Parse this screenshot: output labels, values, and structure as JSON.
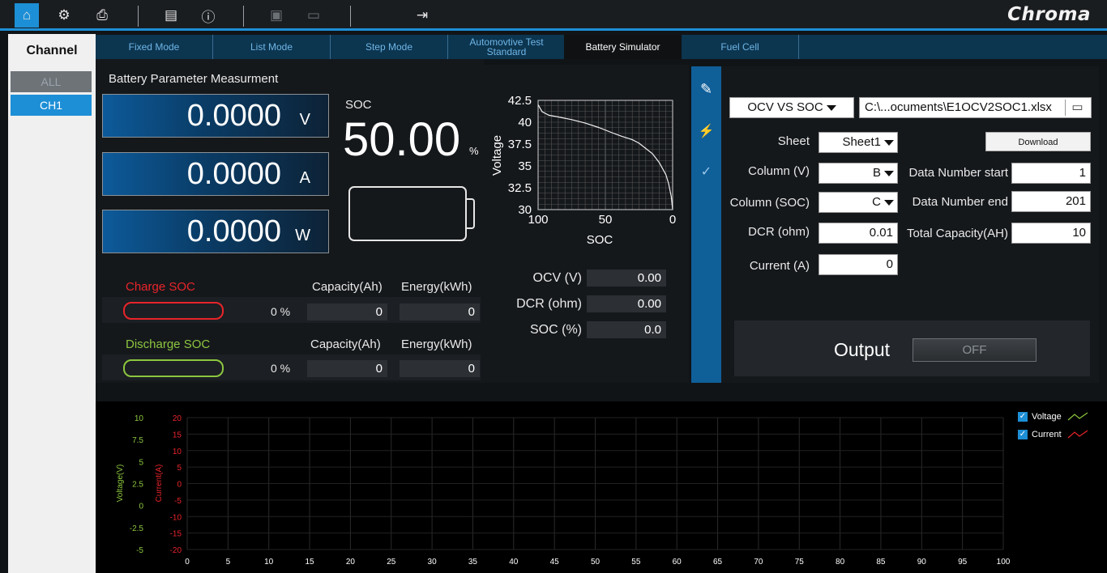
{
  "toolbar": {
    "brand": "Chroma",
    "icons": [
      "home-icon",
      "settings-icon",
      "print-icon",
      "config-icon",
      "info-icon",
      "save-icon",
      "open-folder-icon",
      "exit-icon"
    ]
  },
  "channel": {
    "title": "Channel",
    "items": [
      {
        "label": "ALL"
      },
      {
        "label": "CH1"
      }
    ]
  },
  "tabs": [
    {
      "label": "Fixed Mode"
    },
    {
      "label": "List Mode"
    },
    {
      "label": "Step Mode"
    },
    {
      "label": "Automovtive Test Standard"
    },
    {
      "label": "Battery Simulator"
    },
    {
      "label": "Fuel Cell"
    }
  ],
  "measure": {
    "title": "Battery Parameter Measurment",
    "voltage": {
      "value": "0.0000",
      "unit": "V"
    },
    "current": {
      "value": "0.0000",
      "unit": "A"
    },
    "power": {
      "value": "0.0000",
      "unit": "W"
    },
    "soc_label": "SOC",
    "soc_value": "50.00",
    "soc_unit": "%"
  },
  "charge": {
    "label": "Charge SOC",
    "percent": "0 %",
    "capacity_label": "Capacity(Ah)",
    "energy_label": "Energy(kWh)",
    "capacity": "0",
    "energy": "0",
    "color": "#e8242a"
  },
  "discharge": {
    "label": "Discharge SOC",
    "percent": "0 %",
    "capacity_label": "Capacity(Ah)",
    "energy_label": "Energy(kWh)",
    "capacity": "0",
    "energy": "0",
    "color": "#8cc63f"
  },
  "ocv_chart": {
    "ylabel": "Voltage",
    "xlabel": "SOC",
    "y_ticks": [
      "42.5",
      "40",
      "37.5",
      "35",
      "32.5",
      "30"
    ],
    "x_ticks": [
      "100",
      "50",
      "0"
    ]
  },
  "readouts": [
    {
      "label": "OCV (V)",
      "value": "0.00"
    },
    {
      "label": "DCR (ohm)",
      "value": "0.00"
    },
    {
      "label": "SOC (%)",
      "value": "0.0"
    }
  ],
  "config": {
    "mode_select": "OCV VS SOC",
    "file_path": "C:\\...ocuments\\E1OCV2SOC1.xlsx",
    "download_label": "Download",
    "sheet_label": "Sheet",
    "sheet_value": "Sheet1",
    "column_v_label": "Column (V)",
    "column_v_value": "B",
    "column_soc_label": "Column (SOC)",
    "column_soc_value": "C",
    "dcr_label": "DCR (ohm)",
    "dcr_value": "0.01",
    "current_label": "Current (A)",
    "current_value": "0",
    "data_start_label": "Data Number start",
    "data_start_value": "1",
    "data_end_label": "Data Number end",
    "data_end_value": "201",
    "total_cap_label": "Total Capacity(AH)",
    "total_cap_value": "10",
    "output_label": "Output",
    "output_state": "OFF"
  },
  "trend": {
    "voltage_ticks": [
      "10",
      "7.5",
      "5",
      "2.5",
      "0",
      "-2.5",
      "-5"
    ],
    "current_ticks": [
      "20",
      "15",
      "10",
      "5",
      "0",
      "-5",
      "-10",
      "-15",
      "-20"
    ],
    "voltage_axis": "Voltage(V)",
    "current_axis": "Current(A)",
    "x_ticks": [
      "0",
      "5",
      "10",
      "15",
      "20",
      "25",
      "30",
      "35",
      "40",
      "45",
      "50",
      "55",
      "60",
      "65",
      "70",
      "75",
      "80",
      "85",
      "90",
      "95",
      "100"
    ],
    "legend": [
      {
        "name": "Voltage",
        "color": "#8cc63f",
        "checked": true
      },
      {
        "name": "Current",
        "color": "#e8242a",
        "checked": true
      }
    ]
  },
  "chart_data": [
    {
      "type": "line",
      "title": "",
      "xlabel": "SOC",
      "ylabel": "Voltage",
      "xlim": [
        100,
        0
      ],
      "ylim": [
        30,
        42.5
      ],
      "grid": true,
      "series": [
        {
          "values_x": [
            100,
            97,
            92,
            85,
            75,
            65,
            55,
            45,
            38,
            30,
            25,
            20,
            15,
            10,
            5,
            3,
            1,
            0
          ],
          "values_y": [
            42,
            41.2,
            40.8,
            40.6,
            40.3,
            39.9,
            39.4,
            38.8,
            38.4,
            38.0,
            37.6,
            37.0,
            36.4,
            35.4,
            34.0,
            33.0,
            31.5,
            30
          ]
        }
      ]
    },
    {
      "type": "line",
      "title": "",
      "xlim": [
        0,
        100
      ],
      "ylim": [
        -5,
        10
      ],
      "grid": true,
      "legend_position": "top-right",
      "series": [
        {
          "name": "Voltage",
          "values": []
        },
        {
          "name": "Current",
          "values": []
        }
      ]
    }
  ]
}
